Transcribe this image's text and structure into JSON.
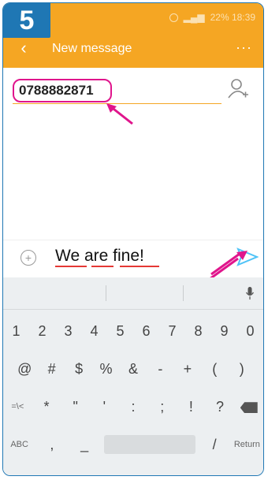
{
  "step_number": "5",
  "statusbar": {
    "right_text": "22% 18:39"
  },
  "appbar": {
    "title": "New message",
    "more": "···"
  },
  "recipient": {
    "value": "0788882871"
  },
  "compose": {
    "message": "We are fine!"
  },
  "keyboard": {
    "numbers": [
      "1",
      "2",
      "3",
      "4",
      "5",
      "6",
      "7",
      "8",
      "9",
      "0"
    ],
    "symbols1": [
      "@",
      "#",
      "$",
      "%",
      "&",
      "-",
      "+",
      "(",
      ")"
    ],
    "symbols2": [
      "=\\<",
      "*",
      "\"",
      "'",
      ":",
      ";",
      "!",
      "?"
    ],
    "bottom": {
      "abc": "ABC",
      "comma": ",",
      "underscore": "_",
      "slash": "/",
      "return": "Return"
    }
  },
  "colors": {
    "accent": "#f5a623",
    "highlight": "#e0158c",
    "badge": "#1f77b4"
  }
}
